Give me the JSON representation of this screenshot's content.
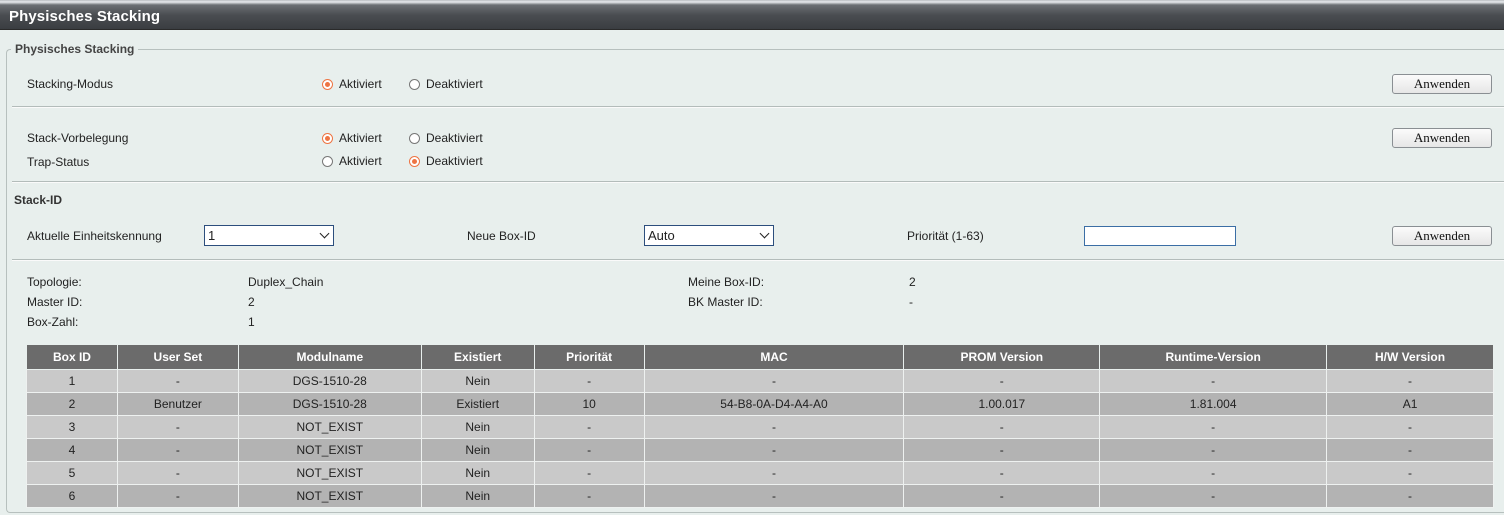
{
  "title": "Physisches Stacking",
  "section_legend": "Physisches Stacking",
  "rows": {
    "stacking_mode": {
      "label": "Stacking-Modus",
      "on": "Aktiviert",
      "off": "Deaktiviert",
      "selected": "on",
      "apply": "Anwenden"
    },
    "stack_preempt": {
      "label": "Stack-Vorbelegung",
      "on": "Aktiviert",
      "off": "Deaktiviert",
      "selected": "on",
      "apply": "Anwenden"
    },
    "trap_status": {
      "label": "Trap-Status",
      "on": "Aktiviert",
      "off": "Deaktiviert",
      "selected": "off"
    }
  },
  "stack_id": {
    "heading": "Stack-ID",
    "current_unit_label": "Aktuelle Einheitskennung",
    "current_unit_value": "1",
    "new_box_label": "Neue Box-ID",
    "new_box_value": "Auto",
    "priority_label": "Priorität (1-63)",
    "priority_value": "",
    "apply": "Anwenden"
  },
  "info": {
    "topology_label": "Topologie:",
    "topology_value": "Duplex_Chain",
    "master_label": "Master ID:",
    "master_value": "2",
    "boxcount_label": "Box-Zahl:",
    "boxcount_value": "1",
    "mybox_label": "Meine Box-ID:",
    "mybox_value": "2",
    "bkmaster_label": "BK Master ID:",
    "bkmaster_value": "-"
  },
  "table": {
    "headers": [
      "Box ID",
      "User Set",
      "Modulname",
      "Existiert",
      "Priorität",
      "MAC",
      "PROM Version",
      "Runtime-Version",
      "H/W Version"
    ],
    "rows": [
      [
        "1",
        "-",
        "DGS-1510-28",
        "Nein",
        "-",
        "-",
        "-",
        "-",
        "-"
      ],
      [
        "2",
        "Benutzer",
        "DGS-1510-28",
        "Existiert",
        "10",
        "54-B8-0A-D4-A4-A0",
        "1.00.017",
        "1.81.004",
        "A1"
      ],
      [
        "3",
        "-",
        "NOT_EXIST",
        "Nein",
        "-",
        "-",
        "-",
        "-",
        "-"
      ],
      [
        "4",
        "-",
        "NOT_EXIST",
        "Nein",
        "-",
        "-",
        "-",
        "-",
        "-"
      ],
      [
        "5",
        "-",
        "NOT_EXIST",
        "Nein",
        "-",
        "-",
        "-",
        "-",
        "-"
      ],
      [
        "6",
        "-",
        "NOT_EXIST",
        "Nein",
        "-",
        "-",
        "-",
        "-",
        "-"
      ]
    ]
  },
  "colors": {
    "accent_radio": "#ee7443",
    "table_header": "#6b6b6b",
    "background": "#e8efed"
  }
}
